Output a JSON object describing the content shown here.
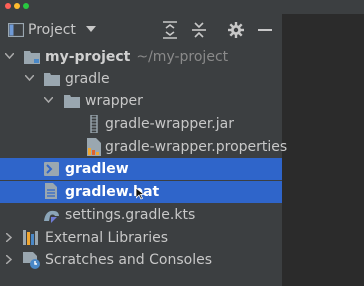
{
  "toolwindow": {
    "title": "Project"
  },
  "tree": {
    "root": {
      "name": "my-project",
      "path": "~/my-project"
    },
    "gradle": "gradle",
    "wrapper": "wrapper",
    "jar": "gradle-wrapper.jar",
    "props": "gradle-wrapper.properties",
    "gradlew": "gradlew",
    "gradlew_bat": "gradlew.bat",
    "settings": "settings.gradle.kts",
    "ext_libs": "External Libraries",
    "scratches": "Scratches and Consoles"
  },
  "colors": {
    "selection": "#2f65ca",
    "panel": "#3c3f41",
    "editor": "#2b2b2b",
    "traffic_red": "#ff5f57",
    "traffic_yellow": "#febc2e",
    "traffic_green": "#28c840"
  },
  "icons": {
    "window": "project-window-icon",
    "dropdown": "chevron-down-icon",
    "expand_all": "expand-all-icon",
    "collapse_all": "collapse-all-icon",
    "settings": "gear-icon",
    "hide": "minimize-icon"
  }
}
